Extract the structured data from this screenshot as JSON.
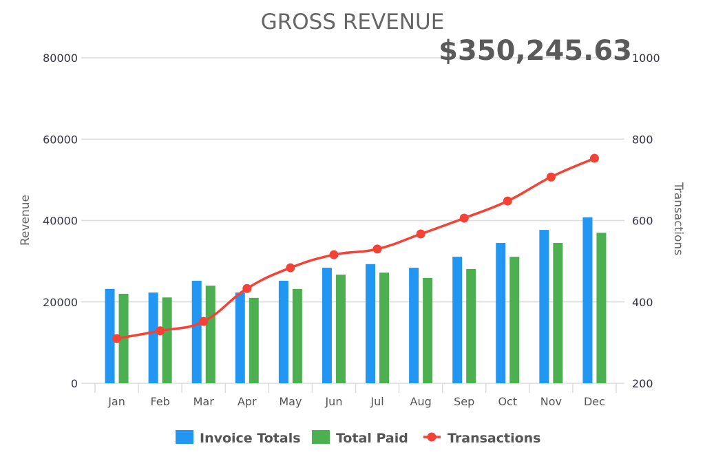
{
  "chart_data": {
    "type": "bar",
    "title": "GROSS REVENUE",
    "total_label": "$350,245.63",
    "categories": [
      "Jan",
      "Feb",
      "Mar",
      "Apr",
      "May",
      "Jun",
      "Jul",
      "Aug",
      "Sep",
      "Oct",
      "Nov",
      "Dec"
    ],
    "series": [
      {
        "name": "Invoice Totals",
        "type": "bar",
        "axis": "left",
        "color": "#2196F3",
        "values": [
          23200,
          22300,
          25200,
          22300,
          25200,
          28400,
          29300,
          28400,
          31100,
          34500,
          37700,
          40800
        ]
      },
      {
        "name": "Total Paid",
        "type": "bar",
        "axis": "left",
        "color": "#4CAF50",
        "values": [
          22000,
          21100,
          24000,
          21000,
          23200,
          26700,
          27200,
          25900,
          28100,
          31100,
          34500,
          37000
        ]
      },
      {
        "name": "Transactions",
        "type": "line",
        "axis": "right",
        "color": "#F44336",
        "values": [
          310,
          329,
          352,
          433,
          484,
          516,
          530,
          567,
          606,
          648,
          707,
          753
        ]
      }
    ],
    "ylabel": "Revenue",
    "y2label": "Transactions",
    "ylim": [
      0,
      80000
    ],
    "y2lim": [
      200,
      1000
    ],
    "yticks": [
      "0",
      "20000",
      "40000",
      "60000",
      "80000"
    ],
    "y2ticks": [
      "200",
      "400",
      "600",
      "800",
      "1000"
    ],
    "grid": true,
    "legend_position": "bottom"
  }
}
